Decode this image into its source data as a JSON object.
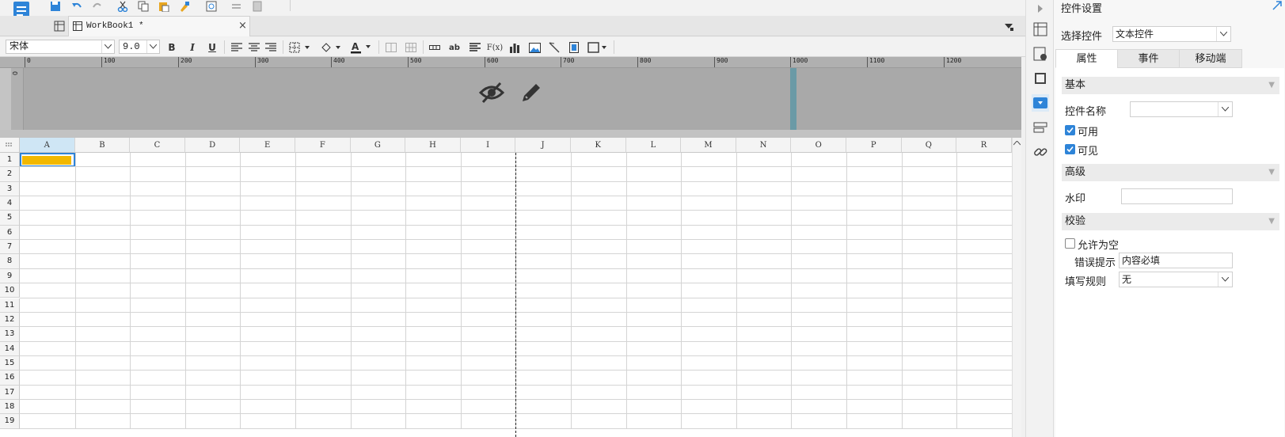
{
  "toolbar": {
    "icons": [
      "logo-icon",
      "save-icon",
      "undo-icon",
      "redo-icon",
      "cut-icon",
      "copy-icon",
      "paste-icon",
      "format-painter-icon",
      "preview-icon",
      "swap-icon",
      "export-icon"
    ]
  },
  "tabs": {
    "workbook_label": "WorkBook1 *",
    "close": "×"
  },
  "format": {
    "font": "宋体",
    "size": "9.0",
    "bold": "B",
    "italic": "I",
    "underline": "U",
    "text_ab": "ab",
    "fx": "F(x)"
  },
  "ruler": {
    "ticks": [
      "0",
      "100",
      "200",
      "300",
      "400",
      "500",
      "600",
      "700",
      "800",
      "900",
      "1000",
      "1100",
      "1200"
    ],
    "vtick": "0"
  },
  "grid": {
    "columns": [
      "A",
      "B",
      "C",
      "D",
      "E",
      "F",
      "G",
      "H",
      "I",
      "J",
      "K",
      "L",
      "M",
      "N",
      "O",
      "P",
      "Q",
      "R"
    ],
    "rows": [
      "1",
      "2",
      "3",
      "4",
      "5",
      "6",
      "7",
      "8",
      "9",
      "10",
      "11",
      "12",
      "13",
      "14",
      "15",
      "16",
      "17",
      "18",
      "19"
    ],
    "selected_cell": "A1",
    "selected_cell_color": "#f2b800"
  },
  "panel": {
    "title": "控件设置",
    "select_label": "选择控件",
    "select_value": "文本控件",
    "tabs": [
      "属性",
      "事件",
      "移动端"
    ],
    "section_basic": "基本",
    "name_label": "控件名称",
    "name_value": "",
    "enabled_label": "可用",
    "enabled": true,
    "visible_label": "可见",
    "visible": true,
    "section_advanced": "高级",
    "watermark_label": "水印",
    "watermark_value": "",
    "section_validate": "校验",
    "allow_empty_label": "允许为空",
    "allow_empty": false,
    "error_label": "错误提示",
    "error_value": "内容必填",
    "rule_label": "填写规则",
    "rule_value": "无"
  },
  "colors": {
    "accent": "#2e84d8",
    "header_area": "#a9a9a9",
    "header_border": "#6b9aa6"
  }
}
